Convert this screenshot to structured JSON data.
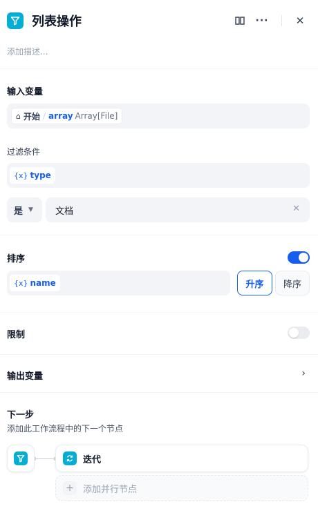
{
  "header": {
    "title": "列表操作",
    "icon": "filter-icon",
    "accent": "#06aed4"
  },
  "description_placeholder": "添加描述...",
  "input_section": {
    "title": "输入变量",
    "variable": {
      "node": "开始",
      "separator": "/",
      "name": "array",
      "type": "Array[File]"
    }
  },
  "filter_section": {
    "title": "过滤条件",
    "variable": {
      "icon_text": "{x}",
      "name": "type"
    },
    "operator": "是",
    "value": "文档"
  },
  "sort_section": {
    "title": "排序",
    "enabled": true,
    "variable": {
      "icon_text": "{x}",
      "name": "name"
    },
    "asc_label": "升序",
    "desc_label": "降序",
    "selected": "升序"
  },
  "limit_section": {
    "title": "限制",
    "enabled": false
  },
  "output_section": {
    "title": "输出变量"
  },
  "next_step": {
    "title": "下一步",
    "subtitle": "添加此工作流程中的下一个节点",
    "next_node_label": "迭代",
    "add_parallel_label": "添加并行节点"
  },
  "colors": {
    "primary": "#155eef",
    "node_icon": "#06aed4",
    "muted": "#98a2b3"
  }
}
